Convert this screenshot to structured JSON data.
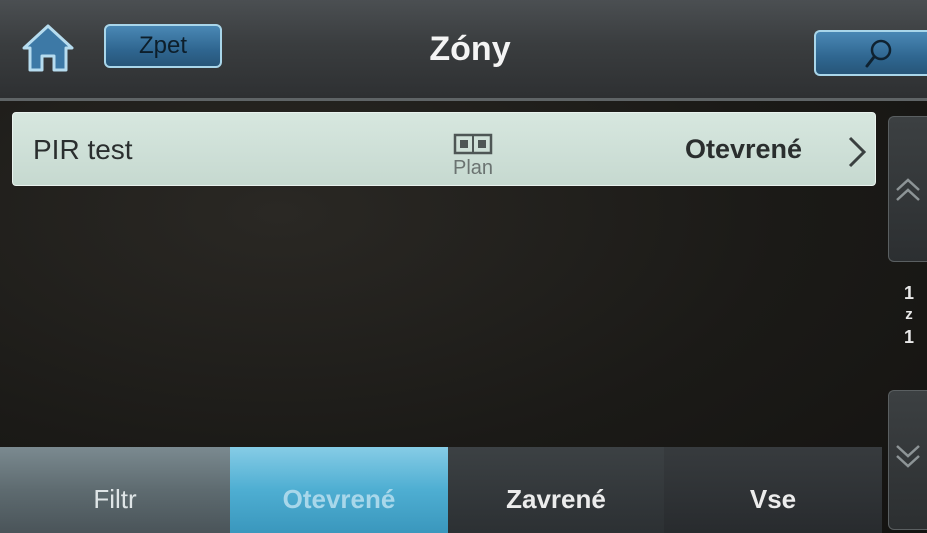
{
  "header": {
    "back_label": "Zpet",
    "title": "Zóny"
  },
  "zones": [
    {
      "name": "PIR test",
      "plan_label": "Plan",
      "status": "Otevrené"
    }
  ],
  "pager": {
    "current": "1",
    "of": "z",
    "total": "1"
  },
  "tabs": {
    "filter": "Filtr",
    "open": "Otevrené",
    "closed": "Zavrené",
    "all": "Vse"
  },
  "icons": {
    "home": "home-icon",
    "search": "search-icon",
    "plan": "floor-plan-icon",
    "chevron": "chevron-right-icon",
    "up": "double-chevron-up-icon",
    "down": "double-chevron-down-icon"
  },
  "colors": {
    "accent": "#4eaed2",
    "button": "#2f6690",
    "row": "#cfe1d8"
  }
}
